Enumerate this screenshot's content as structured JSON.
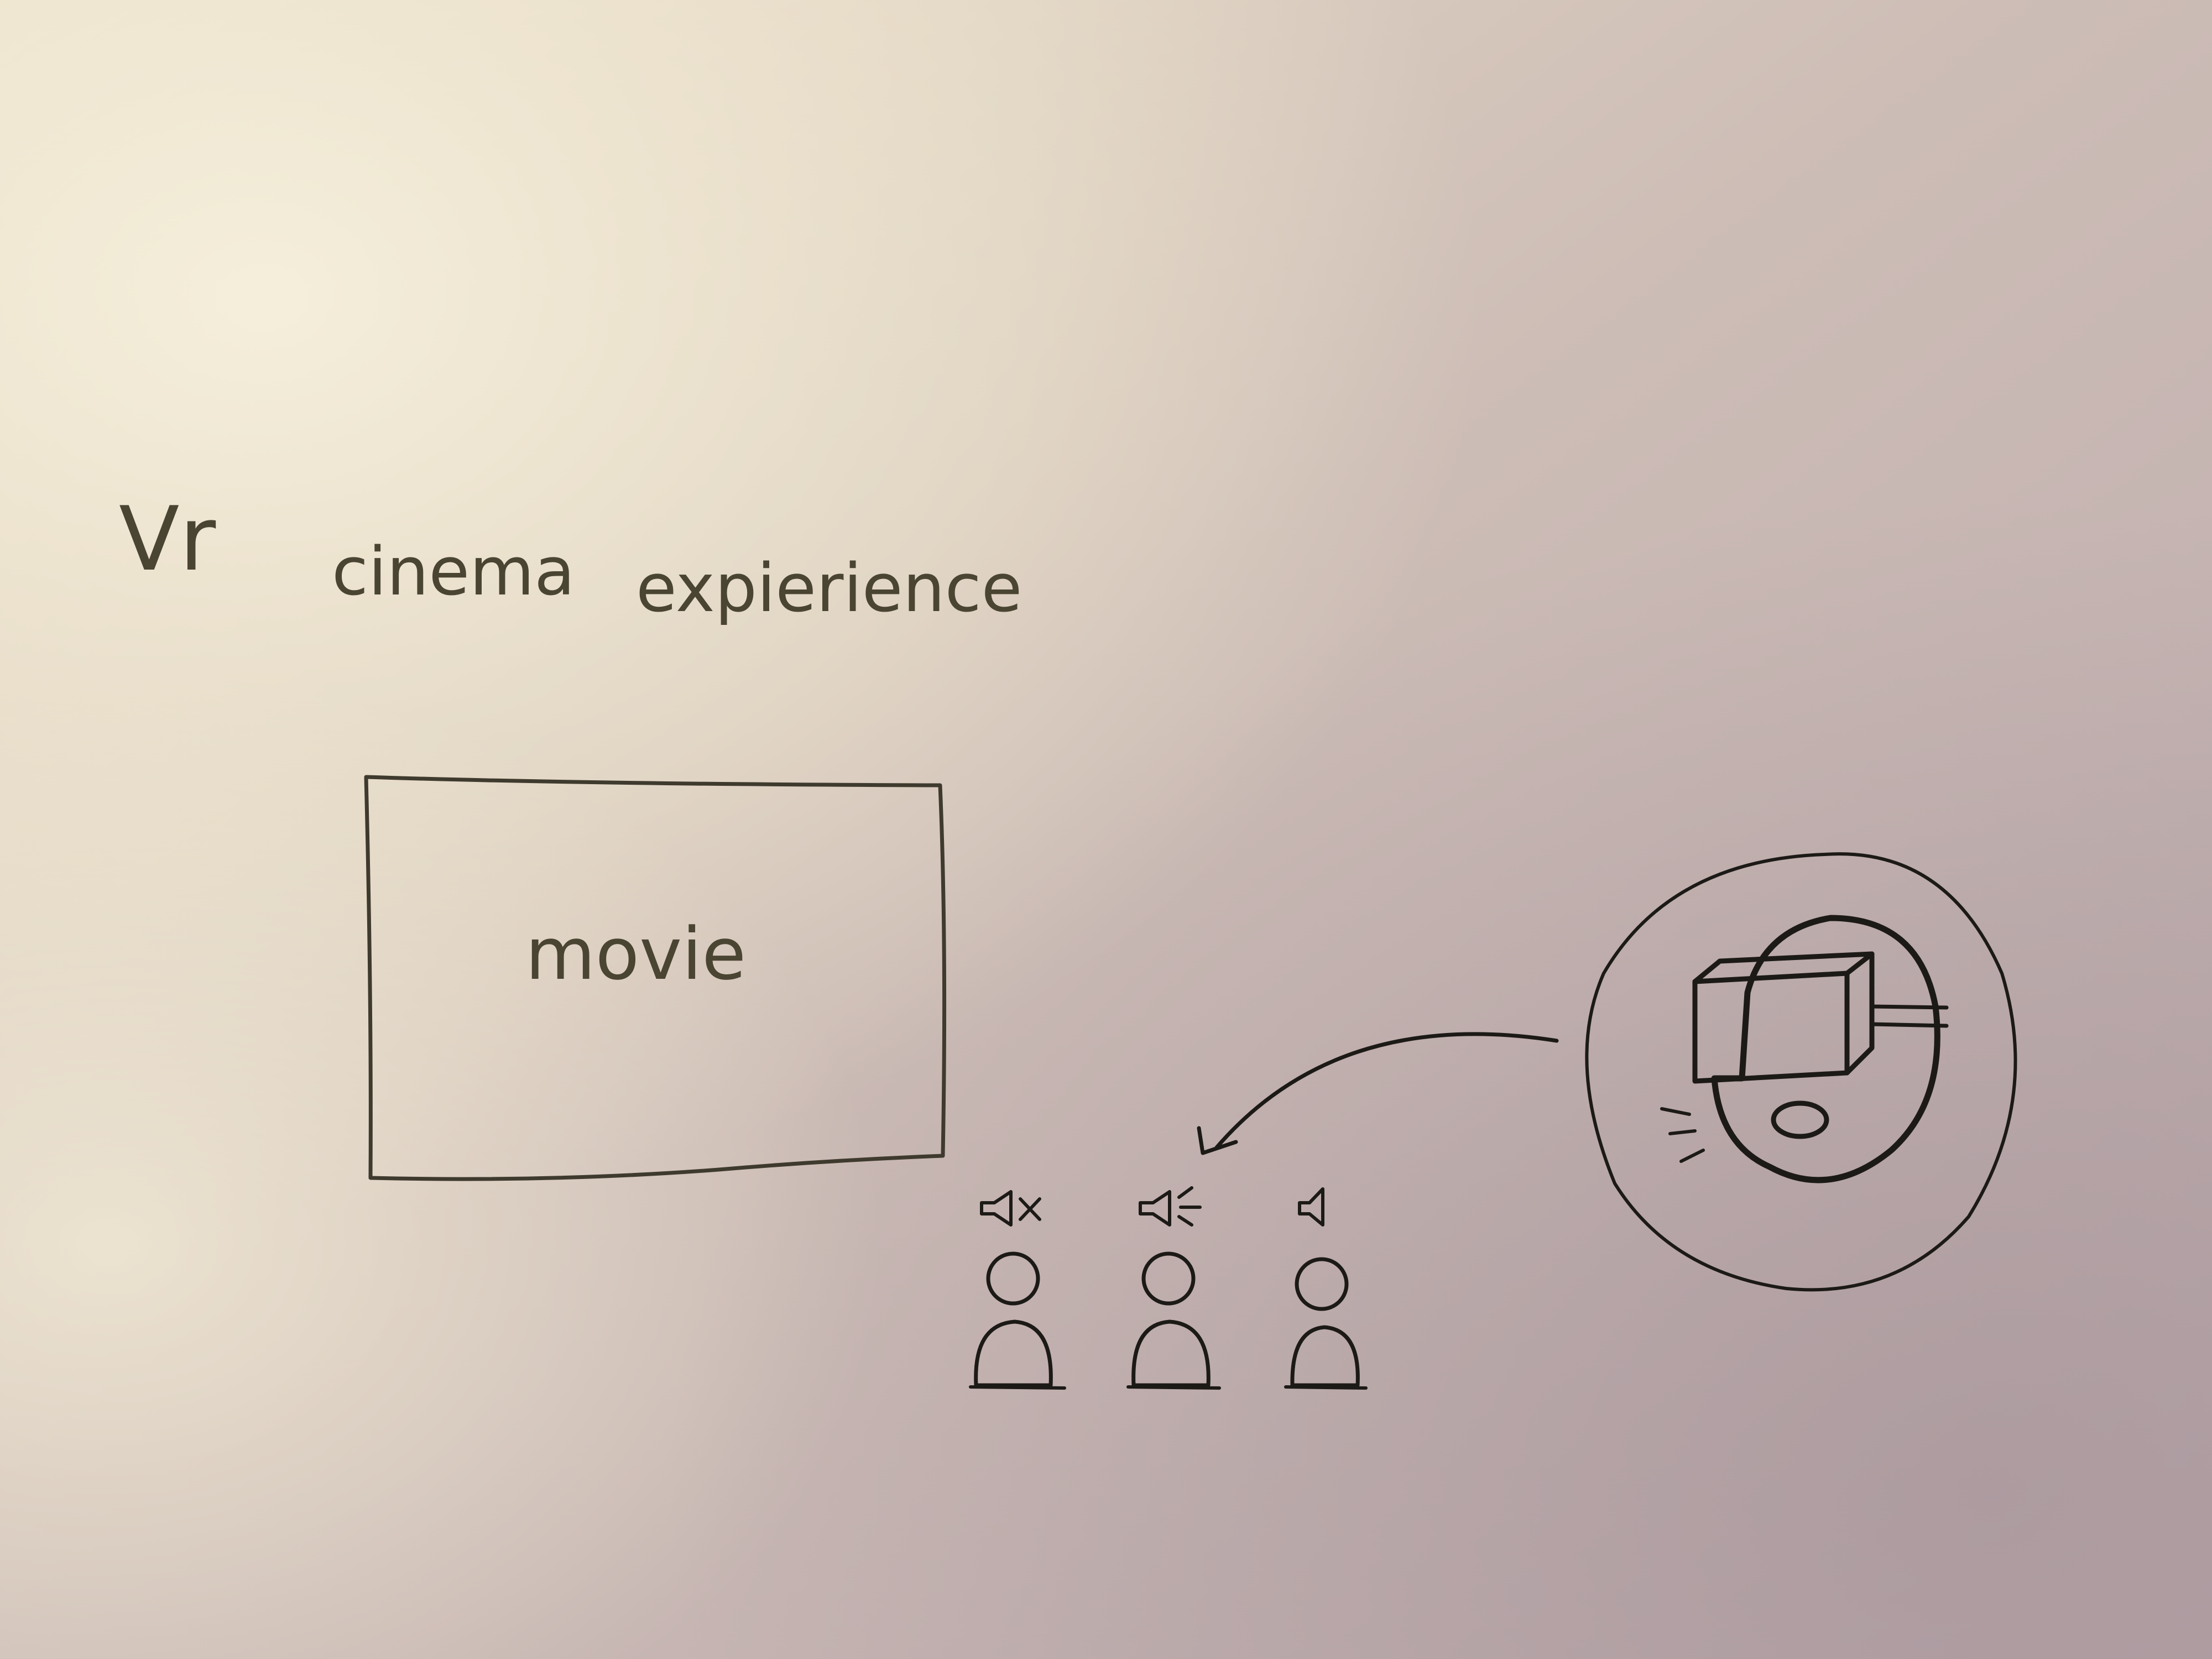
{
  "paper": {
    "base_color": "#d9ccc4",
    "highlight_color": "#f1ead6",
    "shadow_color": "#a8969a",
    "ink_color": "#3f3a2e"
  },
  "title": {
    "word1": "Vr",
    "word2": "cinema",
    "word3": "expierience"
  },
  "screen": {
    "label": "movie"
  },
  "seats": [
    {
      "speaker_state": "muted",
      "speaker_icon": "speaker-muted-icon"
    },
    {
      "speaker_state": "playing",
      "speaker_icon": "speaker-sound-waves-icon"
    },
    {
      "speaker_state": "on",
      "speaker_icon": "speaker-icon"
    }
  ],
  "callout": {
    "icon": "vr-headset-icon",
    "connector": "curved-arrow-icon"
  }
}
